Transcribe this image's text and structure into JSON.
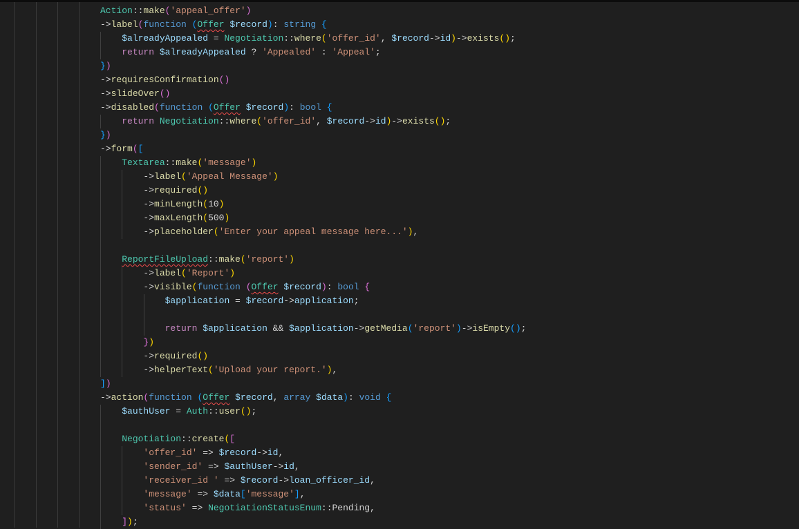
{
  "editor": {
    "lines": [
      [
        [
          "Action",
          "c"
        ],
        [
          "::",
          "p"
        ],
        [
          "make",
          "f"
        ],
        [
          "(",
          "b2"
        ],
        [
          "'appeal_offer'",
          "s"
        ],
        [
          ")",
          "b2"
        ]
      ],
      [
        [
          "->",
          "p"
        ],
        [
          "label",
          "f"
        ],
        [
          "(",
          "b2"
        ],
        [
          "function",
          "k"
        ],
        [
          " ",
          "p"
        ],
        [
          "(",
          "b3"
        ],
        [
          "Offer",
          "sq"
        ],
        [
          " ",
          "p"
        ],
        [
          "$record",
          "v"
        ],
        [
          ")",
          "b3"
        ],
        [
          ": ",
          "p"
        ],
        [
          "string",
          "k"
        ],
        [
          " ",
          "p"
        ],
        [
          "{",
          "b3"
        ]
      ],
      [
        [
          "    ",
          "p"
        ],
        [
          "$alreadyAppealed",
          "v"
        ],
        [
          " = ",
          "p"
        ],
        [
          "Negotiation",
          "c"
        ],
        [
          "::",
          "p"
        ],
        [
          "where",
          "f"
        ],
        [
          "(",
          "b1"
        ],
        [
          "'offer_id'",
          "s"
        ],
        [
          ", ",
          "p"
        ],
        [
          "$record",
          "v"
        ],
        [
          "->",
          "p"
        ],
        [
          "id",
          "v"
        ],
        [
          ")",
          "b1"
        ],
        [
          "->",
          "p"
        ],
        [
          "exists",
          "f"
        ],
        [
          "()",
          "b1"
        ],
        [
          ";",
          "p"
        ]
      ],
      [
        [
          "    ",
          "p"
        ],
        [
          "return",
          "r"
        ],
        [
          " ",
          "p"
        ],
        [
          "$alreadyAppealed",
          "v"
        ],
        [
          " ? ",
          "p"
        ],
        [
          "'Appealed'",
          "s"
        ],
        [
          " : ",
          "p"
        ],
        [
          "'Appeal'",
          "s"
        ],
        [
          ";",
          "p"
        ]
      ],
      [
        [
          "}",
          "b3"
        ],
        [
          ")",
          "b2"
        ]
      ],
      [
        [
          "->",
          "p"
        ],
        [
          "requiresConfirmation",
          "f"
        ],
        [
          "()",
          "b2"
        ]
      ],
      [
        [
          "->",
          "p"
        ],
        [
          "slideOver",
          "f"
        ],
        [
          "()",
          "b2"
        ]
      ],
      [
        [
          "->",
          "p"
        ],
        [
          "disabled",
          "f"
        ],
        [
          "(",
          "b2"
        ],
        [
          "function",
          "k"
        ],
        [
          " ",
          "p"
        ],
        [
          "(",
          "b3"
        ],
        [
          "Offer",
          "sq"
        ],
        [
          " ",
          "p"
        ],
        [
          "$record",
          "v"
        ],
        [
          ")",
          "b3"
        ],
        [
          ": ",
          "p"
        ],
        [
          "bool",
          "k"
        ],
        [
          " ",
          "p"
        ],
        [
          "{",
          "b3"
        ]
      ],
      [
        [
          "    ",
          "p"
        ],
        [
          "return",
          "r"
        ],
        [
          " ",
          "p"
        ],
        [
          "Negotiation",
          "c"
        ],
        [
          "::",
          "p"
        ],
        [
          "where",
          "f"
        ],
        [
          "(",
          "b1"
        ],
        [
          "'offer_id'",
          "s"
        ],
        [
          ", ",
          "p"
        ],
        [
          "$record",
          "v"
        ],
        [
          "->",
          "p"
        ],
        [
          "id",
          "v"
        ],
        [
          ")",
          "b1"
        ],
        [
          "->",
          "p"
        ],
        [
          "exists",
          "f"
        ],
        [
          "()",
          "b1"
        ],
        [
          ";",
          "p"
        ]
      ],
      [
        [
          "}",
          "b3"
        ],
        [
          ")",
          "b2"
        ]
      ],
      [
        [
          "->",
          "p"
        ],
        [
          "form",
          "f"
        ],
        [
          "(",
          "b2"
        ],
        [
          "[",
          "b3"
        ]
      ],
      [
        [
          "    ",
          "p"
        ],
        [
          "Textarea",
          "c"
        ],
        [
          "::",
          "p"
        ],
        [
          "make",
          "f"
        ],
        [
          "(",
          "b1"
        ],
        [
          "'message'",
          "s"
        ],
        [
          ")",
          "b1"
        ]
      ],
      [
        [
          "        ",
          "p"
        ],
        [
          "->",
          "p"
        ],
        [
          "label",
          "f"
        ],
        [
          "(",
          "b1"
        ],
        [
          "'Appeal Message'",
          "s"
        ],
        [
          ")",
          "b1"
        ]
      ],
      [
        [
          "        ",
          "p"
        ],
        [
          "->",
          "p"
        ],
        [
          "required",
          "f"
        ],
        [
          "()",
          "b1"
        ]
      ],
      [
        [
          "        ",
          "p"
        ],
        [
          "->",
          "p"
        ],
        [
          "minLength",
          "f"
        ],
        [
          "(",
          "b1"
        ],
        [
          "10",
          "p"
        ],
        [
          ")",
          "b1"
        ]
      ],
      [
        [
          "        ",
          "p"
        ],
        [
          "->",
          "p"
        ],
        [
          "maxLength",
          "f"
        ],
        [
          "(",
          "b1"
        ],
        [
          "500",
          "p"
        ],
        [
          ")",
          "b1"
        ]
      ],
      [
        [
          "        ",
          "p"
        ],
        [
          "->",
          "p"
        ],
        [
          "placeholder",
          "f"
        ],
        [
          "(",
          "b1"
        ],
        [
          "'Enter your appeal message here...'",
          "s"
        ],
        [
          ")",
          "b1"
        ],
        [
          ",",
          "p"
        ]
      ],
      [
        [
          "    ",
          "p"
        ]
      ],
      [
        [
          "    ",
          "p"
        ],
        [
          "ReportFileUpload",
          "sq"
        ],
        [
          "::",
          "p"
        ],
        [
          "make",
          "f"
        ],
        [
          "(",
          "b1"
        ],
        [
          "'report'",
          "s"
        ],
        [
          ")",
          "b1"
        ]
      ],
      [
        [
          "        ",
          "p"
        ],
        [
          "->",
          "p"
        ],
        [
          "label",
          "f"
        ],
        [
          "(",
          "b1"
        ],
        [
          "'Report'",
          "s"
        ],
        [
          ")",
          "b1"
        ]
      ],
      [
        [
          "        ",
          "p"
        ],
        [
          "->",
          "p"
        ],
        [
          "visible",
          "f"
        ],
        [
          "(",
          "b1"
        ],
        [
          "function",
          "k"
        ],
        [
          " ",
          "p"
        ],
        [
          "(",
          "b2"
        ],
        [
          "Offer",
          "sq"
        ],
        [
          " ",
          "p"
        ],
        [
          "$record",
          "v"
        ],
        [
          ")",
          "b2"
        ],
        [
          ": ",
          "p"
        ],
        [
          "bool",
          "k"
        ],
        [
          " ",
          "p"
        ],
        [
          "{",
          "b2"
        ]
      ],
      [
        [
          "            ",
          "p"
        ],
        [
          "$application",
          "v"
        ],
        [
          " = ",
          "p"
        ],
        [
          "$record",
          "v"
        ],
        [
          "->",
          "p"
        ],
        [
          "application",
          "v"
        ],
        [
          ";",
          "p"
        ]
      ],
      [
        [
          "            ",
          "p"
        ]
      ],
      [
        [
          "            ",
          "p"
        ],
        [
          "return",
          "r"
        ],
        [
          " ",
          "p"
        ],
        [
          "$application",
          "v"
        ],
        [
          " && ",
          "p"
        ],
        [
          "$application",
          "v"
        ],
        [
          "->",
          "p"
        ],
        [
          "getMedia",
          "f"
        ],
        [
          "(",
          "b3"
        ],
        [
          "'report'",
          "s"
        ],
        [
          ")",
          "b3"
        ],
        [
          "->",
          "p"
        ],
        [
          "isEmpty",
          "f"
        ],
        [
          "()",
          "b3"
        ],
        [
          ";",
          "p"
        ]
      ],
      [
        [
          "        ",
          "p"
        ],
        [
          "}",
          "b2"
        ],
        [
          ")",
          "b1"
        ]
      ],
      [
        [
          "        ",
          "p"
        ],
        [
          "->",
          "p"
        ],
        [
          "required",
          "f"
        ],
        [
          "()",
          "b1"
        ]
      ],
      [
        [
          "        ",
          "p"
        ],
        [
          "->",
          "p"
        ],
        [
          "helperText",
          "f"
        ],
        [
          "(",
          "b1"
        ],
        [
          "'Upload your report.'",
          "s"
        ],
        [
          ")",
          "b1"
        ],
        [
          ",",
          "p"
        ]
      ],
      [
        [
          "]",
          "b3"
        ],
        [
          ")",
          "b2"
        ]
      ],
      [
        [
          "->",
          "p"
        ],
        [
          "action",
          "f"
        ],
        [
          "(",
          "b2"
        ],
        [
          "function",
          "k"
        ],
        [
          " ",
          "p"
        ],
        [
          "(",
          "b3"
        ],
        [
          "Offer",
          "sq"
        ],
        [
          " ",
          "p"
        ],
        [
          "$record",
          "v"
        ],
        [
          ", ",
          "p"
        ],
        [
          "array",
          "k"
        ],
        [
          " ",
          "p"
        ],
        [
          "$data",
          "v"
        ],
        [
          ")",
          "b3"
        ],
        [
          ": ",
          "p"
        ],
        [
          "void",
          "k"
        ],
        [
          " ",
          "p"
        ],
        [
          "{",
          "b3"
        ]
      ],
      [
        [
          "    ",
          "p"
        ],
        [
          "$authUser",
          "v"
        ],
        [
          " = ",
          "p"
        ],
        [
          "Auth",
          "c"
        ],
        [
          "::",
          "p"
        ],
        [
          "user",
          "f"
        ],
        [
          "()",
          "b1"
        ],
        [
          ";",
          "p"
        ]
      ],
      [
        [
          "    ",
          "p"
        ]
      ],
      [
        [
          "    ",
          "p"
        ],
        [
          "Negotiation",
          "c"
        ],
        [
          "::",
          "p"
        ],
        [
          "create",
          "f"
        ],
        [
          "(",
          "b1"
        ],
        [
          "[",
          "b2"
        ]
      ],
      [
        [
          "        ",
          "p"
        ],
        [
          "'offer_id'",
          "s"
        ],
        [
          " => ",
          "p"
        ],
        [
          "$record",
          "v"
        ],
        [
          "->",
          "p"
        ],
        [
          "id",
          "v"
        ],
        [
          ",",
          "p"
        ]
      ],
      [
        [
          "        ",
          "p"
        ],
        [
          "'sender_id'",
          "s"
        ],
        [
          " => ",
          "p"
        ],
        [
          "$authUser",
          "v"
        ],
        [
          "->",
          "p"
        ],
        [
          "id",
          "v"
        ],
        [
          ",",
          "p"
        ]
      ],
      [
        [
          "        ",
          "p"
        ],
        [
          "'receiver_id '",
          "s"
        ],
        [
          " => ",
          "p"
        ],
        [
          "$record",
          "v"
        ],
        [
          "->",
          "p"
        ],
        [
          "loan_officer_id",
          "v"
        ],
        [
          ",",
          "p"
        ]
      ],
      [
        [
          "        ",
          "p"
        ],
        [
          "'message'",
          "s"
        ],
        [
          " => ",
          "p"
        ],
        [
          "$data",
          "v"
        ],
        [
          "[",
          "b3"
        ],
        [
          "'message'",
          "s"
        ],
        [
          "]",
          "b3"
        ],
        [
          ",",
          "p"
        ]
      ],
      [
        [
          "        ",
          "p"
        ],
        [
          "'status'",
          "s"
        ],
        [
          " => ",
          "p"
        ],
        [
          "NegotiationStatusEnum",
          "c"
        ],
        [
          "::",
          "p"
        ],
        [
          "Pending",
          "p"
        ],
        [
          ",",
          "p"
        ]
      ],
      [
        [
          "    ",
          "p"
        ],
        [
          "]",
          "b2"
        ],
        [
          ")",
          "b1"
        ],
        [
          ";",
          "p"
        ]
      ]
    ]
  }
}
